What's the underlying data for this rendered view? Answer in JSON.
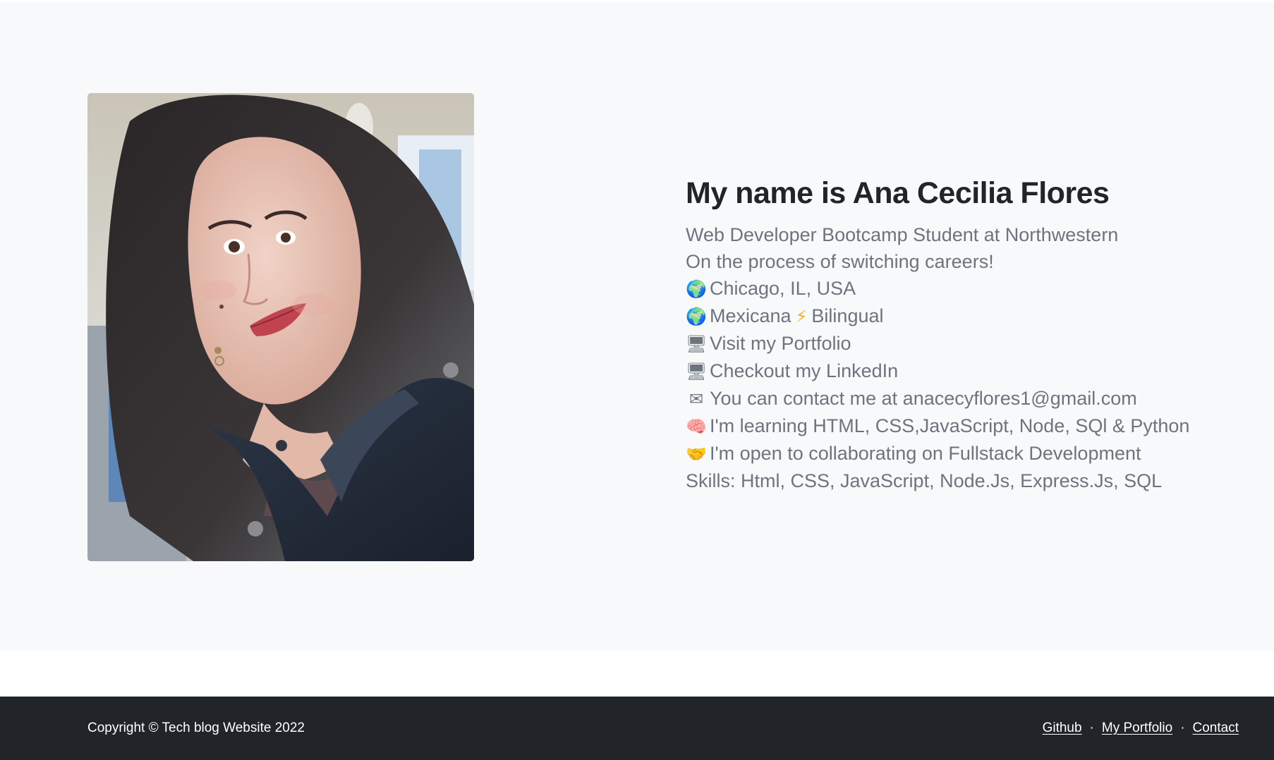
{
  "profile": {
    "heading": "My name is Ana Cecilia Flores",
    "lines": [
      {
        "icon": "",
        "text": "Web Developer Bootcamp Student at Northwestern"
      },
      {
        "icon": "",
        "text": "On the process of switching careers!"
      },
      {
        "icon": "🌍",
        "icon_name": "globe-icon",
        "text": "Chicago, IL, USA"
      },
      {
        "icon": "🌍",
        "icon_name": "globe-icon",
        "text_before": "Mexicana",
        "bolt": "⚡",
        "text_after": "Bilingual"
      },
      {
        "icon": "🖥",
        "icon_name": "desktop-computer-icon",
        "text": "Visit my Portfolio"
      },
      {
        "icon": "🖥",
        "icon_name": "desktop-computer-icon",
        "text": "Checkout my LinkedIn"
      },
      {
        "icon": "✉",
        "icon_name": "envelope-icon",
        "text": "You can contact me at anacecyflores1@gmail.com"
      },
      {
        "icon": "🧠",
        "icon_name": "brain-icon",
        "text": "I'm learning HTML, CSS,JavaScript, Node, SQl & Python"
      },
      {
        "icon": "🤝",
        "icon_name": "handshake-icon",
        "text": "I'm open to collaborating on Fullstack Development"
      },
      {
        "icon": "",
        "text": "Skills: Html, CSS, JavaScript, Node.Js, Express.Js, SQL"
      }
    ]
  },
  "footer": {
    "copyright": "Copyright © Tech blog Website 2022",
    "links": [
      "Github",
      "My Portfolio",
      "Contact"
    ],
    "separator": "·"
  },
  "colors": {
    "hero_background": "#f8f9fa",
    "heading": "#212529",
    "body_text": "#6c757d",
    "footer_background": "#212529",
    "footer_text": "#ffffff"
  }
}
